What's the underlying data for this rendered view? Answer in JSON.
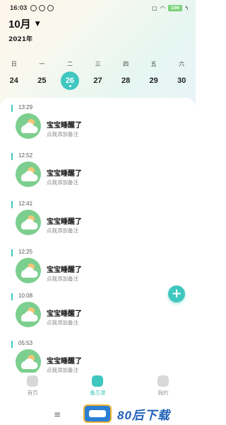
{
  "status_bar": {
    "time": "16:03",
    "left_icons": [
      "notification-icon-1",
      "notification-icon-2",
      "notification-icon-3"
    ],
    "battery": "100"
  },
  "header": {
    "month": "10月",
    "year": "2021年"
  },
  "week": {
    "days": [
      {
        "weekday": "日",
        "date": "24"
      },
      {
        "weekday": "一",
        "date": "25"
      },
      {
        "weekday": "二",
        "date": "26",
        "selected": true
      },
      {
        "weekday": "三",
        "date": "27"
      },
      {
        "weekday": "四",
        "date": "28"
      },
      {
        "weekday": "五",
        "date": "29"
      },
      {
        "weekday": "六",
        "date": "30"
      }
    ]
  },
  "entries": [
    {
      "time": "13:29",
      "title": "宝宝睡醒了",
      "note": "点我添加备注"
    },
    {
      "time": "12:52",
      "title": "宝宝睡醒了",
      "note": "点我添加备注"
    },
    {
      "time": "12:41",
      "title": "宝宝睡醒了",
      "note": "点我添加备注"
    },
    {
      "time": "12:25",
      "title": "宝宝睡醒了",
      "note": "点我添加备注"
    },
    {
      "time": "10:08",
      "title": "宝宝睡醒了",
      "note": "点我添加备注"
    },
    {
      "time": "05:53",
      "title": "宝宝睡醒了",
      "note": "点我添加备注"
    }
  ],
  "fab": {
    "label": "+"
  },
  "tabbar": {
    "items": [
      {
        "label": "首页",
        "icon": "home-icon"
      },
      {
        "label": "备忘录",
        "icon": "memo-icon",
        "active": true
      },
      {
        "label": "我的",
        "icon": "profile-icon"
      }
    ]
  },
  "navbar": {
    "menu": "≡"
  },
  "watermark": {
    "text": "80后下载"
  },
  "colors": {
    "accent": "#3fc7c0",
    "avatar_bg": "#7ccf8e"
  }
}
